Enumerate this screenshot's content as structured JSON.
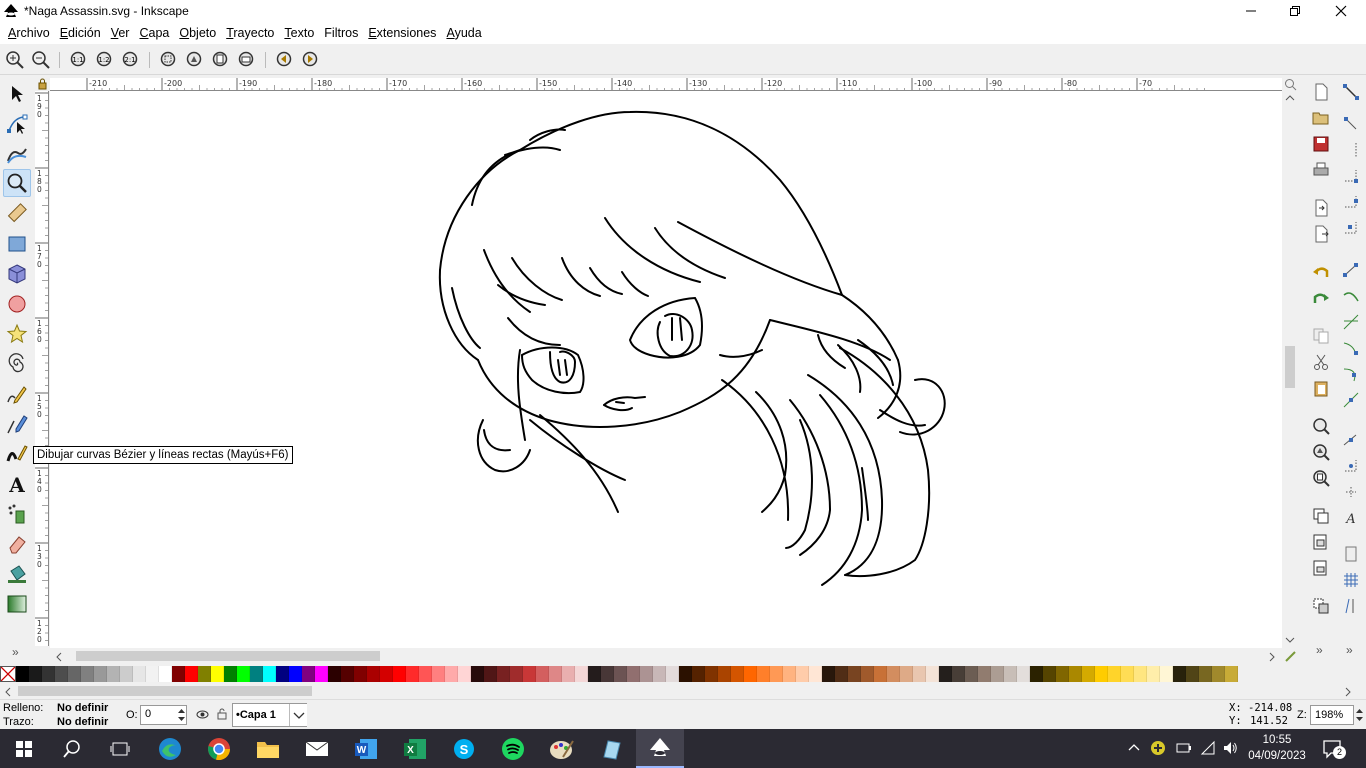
{
  "window": {
    "title": "*Naga Assassin.svg - Inkscape",
    "minimize_icon": "minimize-icon",
    "maximize_icon": "restore-icon",
    "close_icon": "close-icon"
  },
  "menu": {
    "items": [
      {
        "first": "A",
        "rest": "rchivo"
      },
      {
        "first": "E",
        "rest": "dición"
      },
      {
        "first": "V",
        "rest": "er"
      },
      {
        "first": "C",
        "rest": "apa"
      },
      {
        "first": "O",
        "rest": "bjeto"
      },
      {
        "first": "T",
        "rest": "rayecto"
      },
      {
        "first": "T",
        "rest": "exto"
      },
      {
        "first": "F",
        "rest": "iltros"
      },
      {
        "first": "E",
        "rest": "xtensiones"
      },
      {
        "first": "A",
        "rest": "yuda"
      }
    ]
  },
  "ruler": {
    "h_labels": [
      "-210",
      "-200",
      "-190",
      "-180",
      "-170",
      "-160",
      "-150",
      "-140",
      "-130",
      "-120",
      "-110",
      "-100",
      "-90",
      "-80",
      "-70"
    ],
    "v_labels": [
      "190",
      "180",
      "170",
      "160",
      "150",
      "140",
      "130",
      "120"
    ]
  },
  "tooltip": {
    "text": "Dibujar curvas Bézier y líneas rectas (Mayús+F6)"
  },
  "status": {
    "fill_label": "Relleno:",
    "fill_value": "No definir",
    "stroke_label": "Trazo:",
    "stroke_value": "No definir",
    "opacity_label": "O:",
    "opacity_value": "0",
    "layer_name": "•Capa 1",
    "x_label": "X:",
    "x_value": "-214.08",
    "y_label": "Y:",
    "y_value": "141.52",
    "zoom_label": "Z:",
    "zoom_value": "198%"
  },
  "palette": {
    "colors": [
      "#000000",
      "#1a1a1a",
      "#333333",
      "#4d4d4d",
      "#666666",
      "#808080",
      "#999999",
      "#b3b3b3",
      "#cccccc",
      "#e6e6e6",
      "#f2f2f2",
      "#ffffff",
      "#800000",
      "#ff0000",
      "#808000",
      "#ffff00",
      "#008000",
      "#00ff00",
      "#008080",
      "#00ffff",
      "#000080",
      "#0000ff",
      "#800080",
      "#ff00ff",
      "#2b0000",
      "#550000",
      "#800000",
      "#aa0000",
      "#d40000",
      "#ff0000",
      "#ff2a2a",
      "#ff5555",
      "#ff8080",
      "#ffaaaa",
      "#ffd5d5",
      "#280b0b",
      "#501616",
      "#782121",
      "#a02c2c",
      "#c83737",
      "#d35f5f",
      "#de8787",
      "#e9afaf",
      "#f4d7d7",
      "#241c1c",
      "#483737",
      "#6c5353",
      "#916f6f",
      "#ac9393",
      "#c8b7b7",
      "#e3dbdb",
      "#2b1100",
      "#552200",
      "#803300",
      "#aa4400",
      "#d45500",
      "#ff6600",
      "#ff7f2a",
      "#ff9955",
      "#ffb380",
      "#ffccaa",
      "#ffe6d5",
      "#28170b",
      "#502d16",
      "#784421",
      "#a05a2c",
      "#c87137",
      "#d38d5f",
      "#deaa87",
      "#e9c6af",
      "#f4e3d7",
      "#241f1c",
      "#483e37",
      "#6c5d53",
      "#917c6f",
      "#ac9d93",
      "#c8beb7",
      "#e3dedb",
      "#2b2200",
      "#554400",
      "#806600",
      "#aa8800",
      "#d4aa00",
      "#ffcc00",
      "#ffd42a",
      "#ffdd55",
      "#ffe680",
      "#ffeeaa",
      "#fff6d5",
      "#28220b",
      "#504416",
      "#786721",
      "#a0892c",
      "#c8ab37"
    ]
  },
  "taskbar": {
    "time": "10:55",
    "date": "04/09/2023",
    "notification_count": "2",
    "apps": [
      "start-icon",
      "search-icon",
      "task-view-icon",
      "edge-icon",
      "chrome-icon",
      "file-explorer-icon",
      "mail-icon",
      "word-icon",
      "excel-icon",
      "skype-icon",
      "spotify-icon",
      "paint-icon",
      "app-icon",
      "inkscape-icon"
    ]
  }
}
